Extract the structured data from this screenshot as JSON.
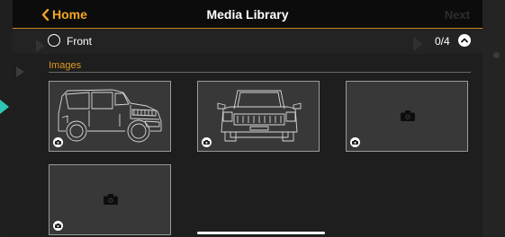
{
  "header": {
    "back_label": "Home",
    "title": "Media Library",
    "next_label": "Next"
  },
  "section": {
    "label": "Front",
    "counter": "0/4"
  },
  "images": {
    "heading": "Images",
    "thumbnails": [
      {
        "name": "thumb-side-view",
        "content": "car-side-outline"
      },
      {
        "name": "thumb-front-view",
        "content": "car-front-outline"
      },
      {
        "name": "thumb-empty-1",
        "content": "camera-placeholder"
      },
      {
        "name": "thumb-empty-2",
        "content": "camera-placeholder"
      }
    ]
  },
  "colors": {
    "accent": "#f5a623",
    "header_bg": "#0c0c0c",
    "panel_bg": "#1e1e1e",
    "thumb_bg": "#383838"
  },
  "icons": [
    "chevron-left-icon",
    "radio-icon",
    "chevron-up-icon",
    "camera-icon"
  ]
}
